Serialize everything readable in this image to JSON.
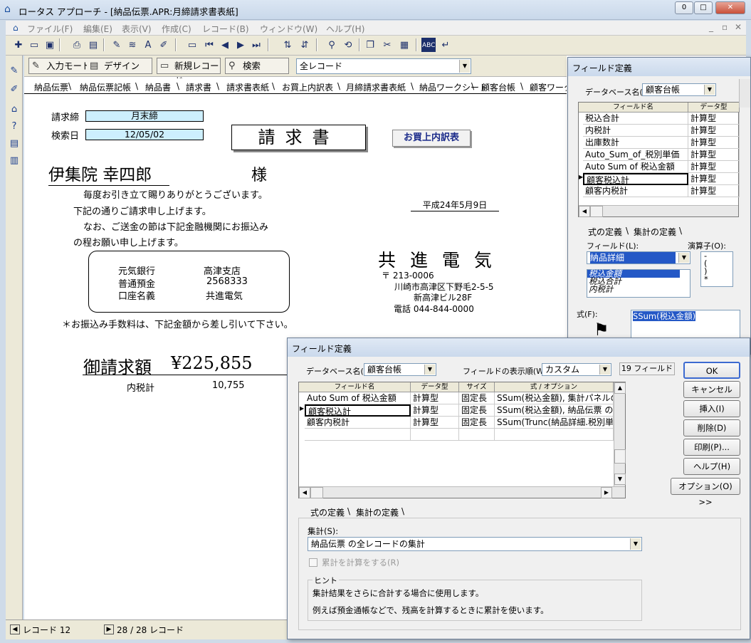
{
  "window": {
    "title": "ロータス アプローチ - [納品伝票.APR:月締請求書表紙]",
    "minimize": "0",
    "maximize": "□",
    "close": "✕"
  },
  "menu": [
    "ファイル(F)",
    "編集(E)",
    "表示(V)",
    "作成(C)",
    "レコード(B)",
    "ウィンドウ(W)",
    "ヘルプ(H)"
  ],
  "actions": {
    "input_mode": "入力モード",
    "design": "デザイン",
    "new_record": "新規レコード",
    "search": "検索",
    "record_filter": "全レコード"
  },
  "tabs": [
    "納品伝票",
    "納品伝票記帳",
    "納品書",
    "請求書",
    "請求書表紙",
    "お買上内訳表",
    "月締請求書表紙",
    "納品ワークシート",
    "顧客台帳",
    "顧客ワークシ"
  ],
  "document": {
    "label_close": "請求締",
    "value_close": "月末締",
    "label_search_date": "検索日",
    "value_search_date": "12/05/02",
    "title": "請求書",
    "button_purchase": "お買上内訳表",
    "customer_name": "伊集院 幸四郎",
    "honorific": "様",
    "greeting": [
      "毎度お引き立て賜りありがとうございます。",
      "下記の通りご請求申し上げます。",
      "なお、ご送金の節は下記金融機関にお振込み",
      "の程お願い申し上げます。"
    ],
    "date": "平成24年5月9日",
    "bank": {
      "bank_name": "元気銀行",
      "branch": "高津支店",
      "account_type": "普通預金",
      "account_no": "2568333",
      "holder_label": "口座名義",
      "holder": "共進電気"
    },
    "company": {
      "name": "共 進 電 気",
      "postal": "〒 213-0006",
      "address1": "川崎市高津区下野毛2-5-5",
      "address2": "新高津ビル28F",
      "phone": "電話 044-844-0000"
    },
    "fee_note": "＊お振込み手数料は、下記金額から差し引いて下さい。",
    "amount_label": "御請求額",
    "amount": "¥225,855",
    "tax_label": "内税計",
    "tax_value": "10,755"
  },
  "status": {
    "record": "レコード 12",
    "count": "28 / 28 レコード"
  },
  "dialog_small": {
    "title": "フィールド定義",
    "db_label": "データベース名(B):",
    "db_value": "顧客台帳",
    "col_field": "フィールド名",
    "col_type": "データ型",
    "rows": [
      {
        "name": "税込合計",
        "type": "計算型"
      },
      {
        "name": "内税計",
        "type": "計算型"
      },
      {
        "name": "出庫数計",
        "type": "計算型"
      },
      {
        "name": "Auto_Sum_of_税別単価",
        "type": "計算型"
      },
      {
        "name": "Auto Sum of 税込金額",
        "type": "計算型"
      },
      {
        "name": "顧客税込計",
        "type": "計算型"
      },
      {
        "name": "顧客内税計",
        "type": "計算型"
      }
    ],
    "tab_formula": "式の定義",
    "tab_summary": "集計の定義",
    "field_label": "フィールド(L):",
    "field_value": "納品詳細",
    "operator_label": "演算子(O):",
    "operators": [
      "-",
      "(",
      ")",
      "*"
    ],
    "field_list": [
      "税込金額",
      "税込合計",
      "内税計"
    ],
    "formula_label": "式(F):",
    "formula_value": "SSum(税込金額)"
  },
  "dialog_main": {
    "title": "フィールド定義",
    "db_label": "データベース名(B):",
    "db_value": "顧客台帳",
    "order_label": "フィールドの表示順(W):",
    "order_value": "カスタム",
    "field_count": "19 フィールド",
    "columns": [
      "フィールド名",
      "データ型",
      "サイズ",
      "式 / オプション"
    ],
    "rows": [
      {
        "name": "Auto Sum of 税込金額",
        "type": "計算型",
        "size": "固定長",
        "opt": "SSum(税込金額), 集計パネルの"
      },
      {
        "name": "顧客税込計",
        "type": "計算型",
        "size": "固定長",
        "opt": "SSum(税込金額), 納品伝票 の"
      },
      {
        "name": "顧客内税計",
        "type": "計算型",
        "size": "固定長",
        "opt": "SSum(Trunc(納品詳細.税別単"
      }
    ],
    "buttons": [
      "OK",
      "キャンセル",
      "挿入(I)",
      "削除(D)",
      "印刷(P)...",
      "ヘルプ(H)",
      "オプション(O) >>"
    ],
    "tab_formula": "式の定義",
    "tab_summary": "集計の定義",
    "summary_label": "集計(S):",
    "summary_value": "納品伝票 の全レコードの集計",
    "cumulative_label": "累計を計算をする(R)",
    "hint_label": "ヒント",
    "hint_1": "集計結果をさらに合計する場合に使用します。",
    "hint_2": "例えば預金通帳などで、残高を計算するときに累計を使います。"
  }
}
